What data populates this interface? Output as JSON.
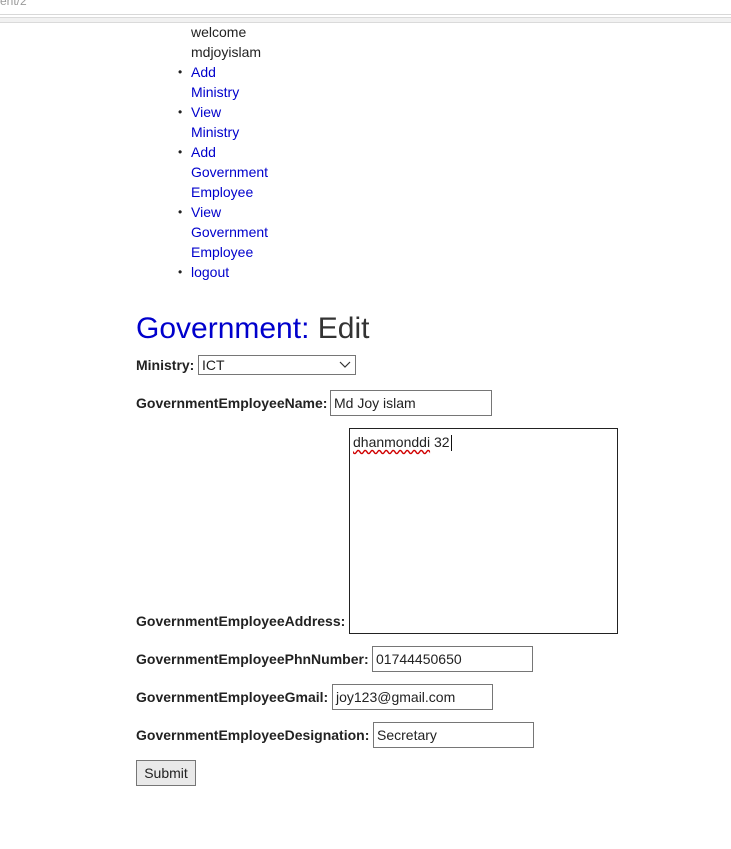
{
  "browser": {
    "url_fragment": "ent/2"
  },
  "nav": {
    "welcome": "welcome",
    "username": "mdjoyislam",
    "items": [
      {
        "line1": "Add",
        "line2": "Ministry",
        "line3": ""
      },
      {
        "line1": "View",
        "line2": "Ministry",
        "line3": ""
      },
      {
        "line1": "Add",
        "line2": "Government",
        "line3": "Employee"
      },
      {
        "line1": "View",
        "line2": "Government",
        "line3": "Employee"
      },
      {
        "line1": "logout",
        "line2": "",
        "line3": ""
      }
    ],
    "bullet": "•"
  },
  "page": {
    "title_entity": "Government",
    "title_sep": ":",
    "title_action": "Edit"
  },
  "form": {
    "ministry_label": "Ministry:",
    "ministry_value": "ICT",
    "name_label": "GovernmentEmployeeName:",
    "name_value": "Md Joy islam",
    "address_label": "GovernmentEmployeeAddress:",
    "address_word1": "dhanmonddi",
    "address_word2": " 32",
    "phone_label": "GovernmentEmployeePhnNumber:",
    "phone_value": "01744450650",
    "gmail_label": "GovernmentEmployeeGmail:",
    "gmail_value": "joy123@gmail.com",
    "designation_label": "GovernmentEmployeeDesignation:",
    "designation_value": "Secretary",
    "submit_label": "Submit"
  },
  "icons": {
    "dropdown": "chevron-down-icon"
  }
}
